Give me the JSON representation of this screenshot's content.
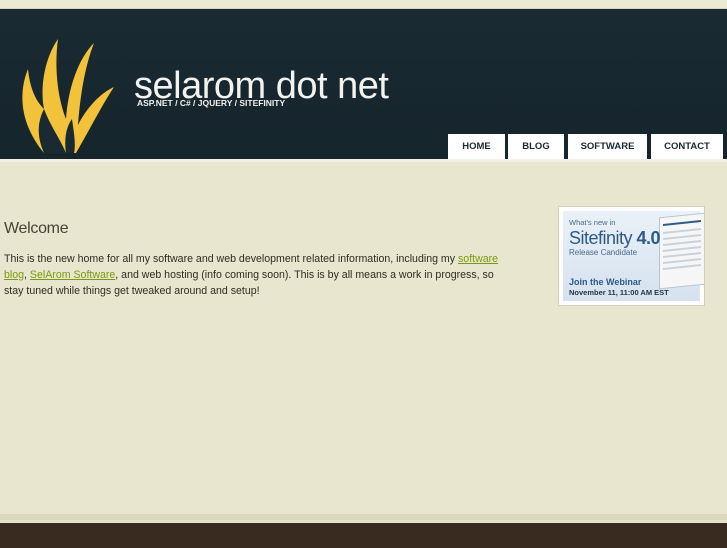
{
  "header": {
    "site_title": "selarom dot net",
    "tagline": "ASP.NET / C# / JQUERY / SITEFINITY"
  },
  "nav": {
    "items": [
      {
        "label": "HOME"
      },
      {
        "label": "BLOG"
      },
      {
        "label": "SOFTWARE"
      },
      {
        "label": "CONTACT"
      }
    ]
  },
  "main": {
    "heading": "Welcome",
    "text_part1": "This is the new home for all my software and web development related information, including my ",
    "link1": "software blog",
    "text_part2": ", ",
    "link2": "SelArom Software",
    "text_part3": ", and web hosting (info coming soon). This is by all means a work in progress, so stay tuned while things get tweaked around and setup!"
  },
  "ad": {
    "line1": "What's new in",
    "product": "Sitefinity",
    "version": "4.0",
    "line3": "Release Candidate",
    "cta": "Join the Webinar",
    "date": "November 11, 11:00 AM EST"
  },
  "colors": {
    "header_bg": "#1a2a33",
    "page_bg": "#e9e6cf",
    "link": "#7a9a10",
    "logo": "#f2c23a",
    "footer": "#3a2b21"
  }
}
